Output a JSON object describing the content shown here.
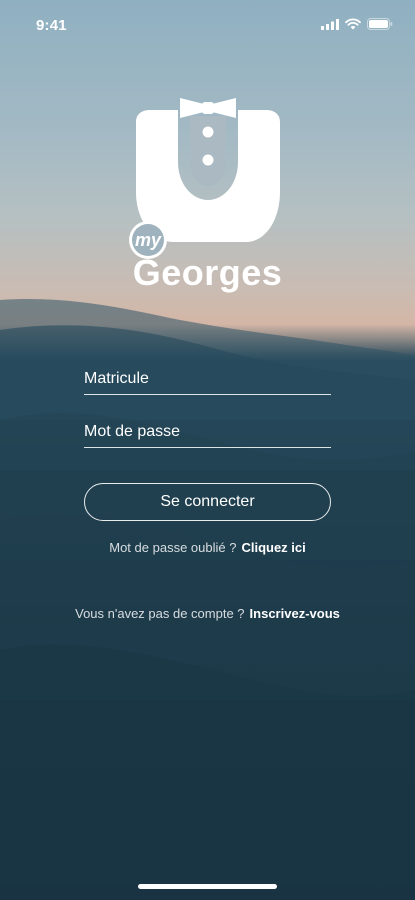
{
  "status_bar": {
    "time": "9:41",
    "icons": [
      "signal-icon",
      "wifi-icon",
      "battery-icon"
    ]
  },
  "logo": {
    "tag": "my",
    "name": "Georges",
    "icon": "tuxedo-icon"
  },
  "form": {
    "matricule_placeholder": "Matricule",
    "password_placeholder": "Mot de passe",
    "login_label": "Se connecter"
  },
  "forgot": {
    "text": "Mot de passe oublié ?",
    "link": "Cliquez ici"
  },
  "register": {
    "text": "Vous n'avez pas de compte ?",
    "link": "Inscrivez-vous"
  },
  "colors": {
    "sky_top": "#8fb0c1",
    "horizon": "#d4b6a6",
    "sea": "#1c3a4b",
    "text": "#ffffff"
  }
}
